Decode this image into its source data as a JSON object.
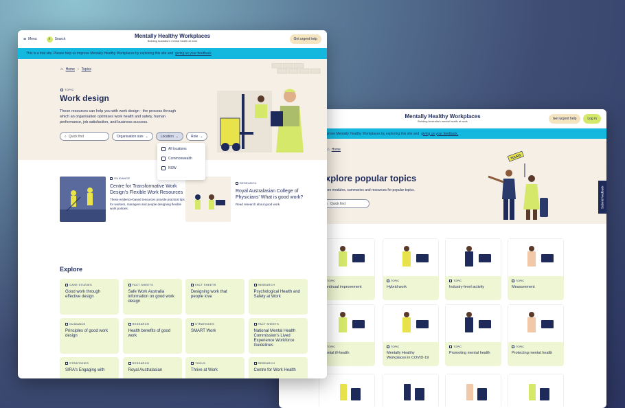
{
  "win_a": {
    "menu": "Menu",
    "search": "Search",
    "logo_title": "Mentally Healthy Workplaces",
    "logo_sub": "Building Australia's mental health at work",
    "urgent": "Get urgent help",
    "banner": "This is a trial site. Please help us improve Mentally Healthy Workplaces by exploring this site and",
    "banner_link": "giving us your feedback",
    "crumbs": [
      "Home",
      "Topics"
    ],
    "topic_tag": "TOPIC",
    "title": "Work design",
    "intro": "These resources can help you with work design - the process through which an organisation optimises work health and safety, human performance, job satisfaction, and business success.",
    "quick_find": "Quick find",
    "filters": [
      "Organisation size",
      "Location",
      "Role"
    ],
    "location_options": [
      "All locations",
      "Commonwealth",
      "NSW"
    ],
    "featured": [
      {
        "tag": "GUIDANCE",
        "title": "Centre for Transformative Work Design's Flexible Work Resources",
        "desc": "These evidence-based resources provide practical tips for workers, managers and people designing flexible work policies."
      },
      {
        "tag": "RESEARCH",
        "title": "Royal Australasian College of Physicians' What is good work?",
        "desc": "Read research about good work."
      }
    ],
    "explore": "Explore",
    "cards": [
      {
        "tag": "CASE STUDIES",
        "title": "Good work through effective design"
      },
      {
        "tag": "FACT SHEETS",
        "title": "Safe Work Australia information on good work design"
      },
      {
        "tag": "FACT SHEETS",
        "title": "Designing work that people love"
      },
      {
        "tag": "RESEARCH",
        "title": "Psychological Health and Safety at Work"
      },
      {
        "tag": "GUIDANCE",
        "title": "Principles of good work design"
      },
      {
        "tag": "RESEARCH",
        "title": "Health benefits of good work"
      },
      {
        "tag": "STRATEGIES",
        "title": "SMART Work"
      },
      {
        "tag": "FACT SHEETS",
        "title": "National Mental Health Commission's Lived Experience Workforce Guidelines"
      },
      {
        "tag": "STRATEGIES",
        "title": "SIRA's Engaging with"
      },
      {
        "tag": "RESEARCH",
        "title": "Royal Australasian"
      },
      {
        "tag": "TOOLS",
        "title": "Thrive at Work"
      },
      {
        "tag": "RESEARCH",
        "title": "Centre for Work Health"
      }
    ]
  },
  "win_b": {
    "search": "h",
    "logo_title": "Mentally Healthy Workplaces",
    "logo_sub": "Building Australia's mental health at work",
    "urgent": "Get urgent help",
    "login": "Log in",
    "banner": "s a trial site. Please help us improve Mentally Healthy Workplaces by exploring this site and",
    "banner_link": "giving us your feedback.",
    "crumb": "Home",
    "title": "xplore popular topics",
    "intro": "lore modules, summaries and resources for popular topics.",
    "quick_find": "Quick find",
    "sign": "TOURS",
    "feedback": "Submit feedback",
    "topics": [
      {
        "tag": "TOPIC",
        "title": "Continual improvement"
      },
      {
        "tag": "TOPIC",
        "title": "Hybrid work"
      },
      {
        "tag": "TOPIC",
        "title": "Industry-level activity"
      },
      {
        "tag": "TOPIC",
        "title": "Measurement"
      },
      {
        "tag": "TOPIC",
        "title": "Mental ill-health"
      },
      {
        "tag": "TOPIC",
        "title": "Mentally Healthy Workplaces in COVID-19"
      },
      {
        "tag": "TOPIC",
        "title": "Promoting mental health"
      },
      {
        "tag": "TOPIC",
        "title": "Protecting mental health"
      }
    ]
  },
  "colors": {
    "navy": "#1e2a5a",
    "cyan": "#14b8de",
    "lime": "#d6e86a",
    "hero": "#f5efe5",
    "card": "#eff6d4"
  }
}
